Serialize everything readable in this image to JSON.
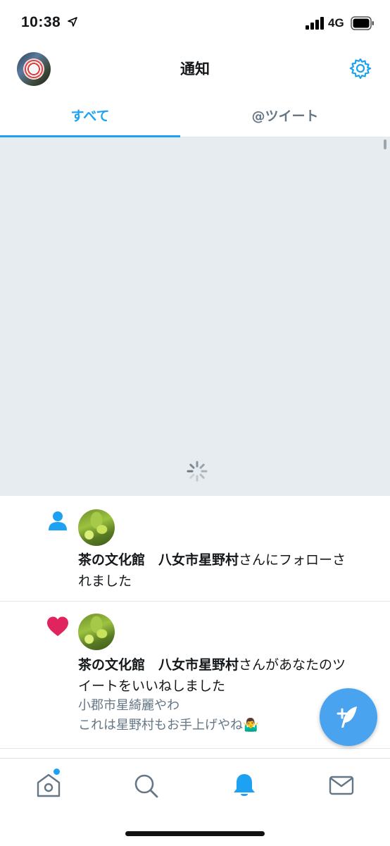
{
  "status_bar": {
    "time": "10:38",
    "network": "4G"
  },
  "header": {
    "title": "通知"
  },
  "tabs": [
    {
      "label": "すべて",
      "active": true
    },
    {
      "label": "@ツイート",
      "active": false
    }
  ],
  "notifications": [
    {
      "type": "follow",
      "icon": "person-icon",
      "name": "茶の文化館　八女市星野村",
      "action_line1": "さんにフォローさ",
      "action_line2": "れました"
    },
    {
      "type": "like",
      "icon": "heart-icon",
      "name": "茶の文化館　八女市星野村",
      "action_line1": "さんがあなたのツ",
      "action_line2": "イートをいいねしました",
      "tweet_line1": "小郡市星綺麗やわ",
      "tweet_line2": "これは星野村もお手上げやね🤷‍♂️"
    }
  ],
  "colors": {
    "accent": "#1da1f2",
    "like": "#e0245e",
    "muted": "#657786",
    "loading_bg": "#e6ecf0"
  },
  "bottom_tabs": [
    {
      "name": "home-icon",
      "badge": true
    },
    {
      "name": "search-icon",
      "badge": false
    },
    {
      "name": "notifications-bell-icon",
      "badge": false,
      "active": true
    },
    {
      "name": "messages-mail-icon",
      "badge": false
    }
  ]
}
